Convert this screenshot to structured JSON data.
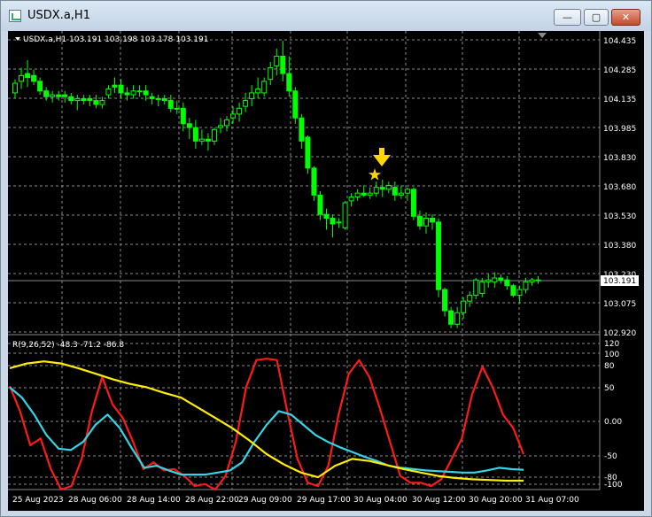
{
  "window": {
    "title": "USDX.a,H1",
    "buttons": {
      "minimize": "—",
      "maximize": "▢",
      "close": "✕"
    }
  },
  "colors": {
    "background": "#000000",
    "grid": "#8a8a8a",
    "candle": "#00ff00",
    "rsi_fast": "#ff1a1a",
    "rsi_medium": "#33d6e6",
    "rsi_slow": "#ffee00",
    "marker": "#ffd700",
    "text": "#ffffff"
  },
  "main_chart": {
    "header": "USDX.a,H1  103.191 103.198 103.178 103.191",
    "price_axis": [
      "104.435",
      "104.285",
      "104.135",
      "103.985",
      "103.830",
      "103.680",
      "103.530",
      "103.380",
      "103.230",
      "103.075",
      "102.920"
    ],
    "current_price": "103.191",
    "marker_icons": [
      "arrow-down-icon",
      "star-icon"
    ]
  },
  "indicator": {
    "header": "R(9,26,52) -48.3 -71.2 -86.8",
    "axis": [
      "120",
      "100",
      "80",
      "50",
      "0.00",
      "-50",
      "-80",
      "-100"
    ]
  },
  "time_axis": [
    "25 Aug 2023",
    "28 Aug 06:00",
    "28 Aug 14:00",
    "28 Aug 22:00",
    "29 Aug 09:00",
    "29 Aug 17:00",
    "30 Aug 04:00",
    "30 Aug 12:00",
    "30 Aug 20:00",
    "31 Aug 07:00"
  ],
  "chart_data": [
    {
      "type": "candlestick",
      "symbol": "USDX.a",
      "timeframe": "H1",
      "ylim": [
        102.92,
        104.435
      ],
      "open": [
        104.16,
        104.22,
        104.26,
        104.25,
        104.22,
        104.17,
        104.14,
        104.15,
        104.15,
        104.14,
        104.12,
        104.13,
        104.13,
        104.12,
        104.1,
        104.15,
        104.2,
        104.2,
        104.16,
        104.15,
        104.17,
        104.17,
        104.14,
        104.13,
        104.13,
        104.12,
        104.08,
        104.08,
        104.0,
        103.98,
        103.91,
        103.92,
        103.91,
        103.98,
        103.99,
        104.03,
        104.05,
        104.09,
        104.13,
        104.16,
        104.16,
        104.23,
        104.3,
        104.35,
        104.26,
        104.17,
        104.03,
        103.93,
        103.77,
        103.63,
        103.53,
        103.51,
        103.49,
        103.46,
        103.6,
        103.62,
        103.64,
        103.63,
        103.64,
        103.67,
        103.66,
        103.67,
        103.63,
        103.64,
        103.66,
        103.52,
        103.47,
        103.51,
        103.49,
        103.14,
        103.03,
        102.96,
        103.02,
        103.08,
        103.11,
        103.12,
        103.18,
        103.18,
        103.2,
        103.19,
        103.16,
        103.11,
        103.14,
        103.18,
        103.19
      ],
      "high": [
        104.23,
        104.29,
        104.33,
        104.28,
        104.24,
        104.19,
        104.17,
        104.17,
        104.17,
        104.16,
        104.15,
        104.15,
        104.15,
        104.15,
        104.14,
        104.2,
        104.24,
        104.23,
        104.19,
        104.2,
        104.2,
        104.2,
        104.16,
        104.15,
        104.15,
        104.15,
        104.12,
        104.11,
        104.03,
        104.02,
        103.97,
        103.95,
        103.98,
        104.03,
        104.04,
        104.09,
        104.11,
        104.16,
        104.2,
        104.24,
        104.24,
        104.32,
        104.39,
        104.43,
        104.35,
        104.19,
        104.05,
        103.94,
        103.78,
        103.65,
        103.56,
        103.53,
        103.51,
        103.6,
        103.64,
        103.66,
        103.68,
        103.67,
        103.7,
        103.71,
        103.7,
        103.7,
        103.68,
        103.67,
        103.67,
        103.55,
        103.54,
        103.53,
        103.51,
        103.15,
        103.05,
        103.05,
        103.1,
        103.13,
        103.2,
        103.2,
        103.22,
        103.23,
        103.22,
        103.21,
        103.17,
        103.16,
        103.2,
        103.2,
        103.21
      ],
      "low": [
        104.13,
        104.18,
        104.19,
        104.2,
        104.15,
        104.12,
        104.11,
        104.12,
        104.11,
        104.1,
        104.07,
        104.1,
        104.09,
        104.08,
        104.08,
        104.13,
        104.16,
        104.13,
        104.12,
        104.13,
        104.14,
        104.12,
        104.1,
        104.09,
        104.1,
        104.06,
        104.05,
        103.96,
        103.92,
        103.87,
        103.89,
        103.86,
        103.89,
        103.95,
        103.96,
        104.0,
        104.01,
        104.06,
        104.09,
        104.13,
        104.14,
        104.2,
        104.25,
        104.22,
        104.14,
        104.0,
        103.87,
        103.74,
        103.6,
        103.5,
        103.45,
        103.41,
        103.46,
        103.45,
        103.57,
        103.6,
        103.62,
        103.61,
        103.62,
        103.62,
        103.64,
        103.6,
        103.61,
        103.6,
        103.5,
        103.45,
        103.43,
        103.45,
        103.1,
        103.0,
        102.94,
        102.94,
        102.99,
        103.05,
        103.09,
        103.1,
        103.15,
        103.15,
        103.17,
        103.14,
        103.1,
        103.07,
        103.12,
        103.16,
        103.17
      ],
      "close": [
        104.21,
        104.25,
        104.24,
        104.22,
        104.17,
        104.14,
        104.15,
        104.14,
        104.14,
        104.12,
        104.13,
        104.12,
        104.12,
        104.1,
        104.12,
        104.18,
        104.19,
        104.16,
        104.15,
        104.17,
        104.17,
        104.15,
        104.13,
        104.13,
        104.12,
        104.08,
        104.08,
        104.0,
        103.98,
        103.91,
        103.92,
        103.91,
        103.97,
        103.99,
        104.02,
        104.05,
        104.08,
        104.12,
        104.16,
        104.18,
        104.22,
        104.29,
        104.35,
        104.26,
        104.17,
        104.03,
        103.91,
        103.77,
        103.63,
        103.53,
        103.51,
        103.48,
        103.49,
        103.59,
        103.62,
        103.64,
        103.63,
        103.64,
        103.67,
        103.66,
        103.68,
        103.63,
        103.64,
        103.66,
        103.52,
        103.47,
        103.51,
        103.49,
        103.14,
        103.03,
        102.96,
        103.02,
        103.08,
        103.11,
        103.19,
        103.18,
        103.19,
        103.2,
        103.19,
        103.16,
        103.11,
        103.14,
        103.18,
        103.19,
        103.19
      ]
    },
    {
      "type": "line",
      "name": "R(9,26,52)",
      "ylim": [
        -110,
        120
      ],
      "series": [
        {
          "name": "9",
          "values": [
            52,
            15,
            -35,
            -25,
            -70,
            -100,
            -95,
            -55,
            15,
            65,
            25,
            5,
            -30,
            -70,
            -60,
            -72,
            -70,
            -80,
            -95,
            -92,
            -100,
            -80,
            -30,
            50,
            90,
            92,
            90,
            15,
            -55,
            -90,
            -95,
            -65,
            10,
            70,
            90,
            65,
            20,
            -30,
            -80,
            -90,
            -90,
            -95,
            -85,
            -55,
            -25,
            40,
            80,
            50,
            10,
            -10,
            -48
          ]
        },
        {
          "name": "26",
          "values": [
            50,
            35,
            10,
            -20,
            -40,
            -42,
            -30,
            -5,
            10,
            -10,
            -40,
            -68,
            -65,
            -72,
            -78,
            -78,
            -78,
            -75,
            -72,
            -60,
            -30,
            -5,
            15,
            10,
            -5,
            -20,
            -30,
            -38,
            -45,
            -52,
            -58,
            -65,
            -68,
            -70,
            -72,
            -73,
            -74,
            -75,
            -75,
            -72,
            -68,
            -70,
            -71
          ]
        },
        {
          "name": "52",
          "values": [
            78,
            85,
            88,
            85,
            78,
            70,
            62,
            55,
            50,
            42,
            35,
            20,
            5,
            -10,
            -28,
            -48,
            -63,
            -75,
            -82,
            -65,
            -55,
            -58,
            -64,
            -70,
            -75,
            -80,
            -83,
            -85,
            -86,
            -87,
            -87
          ]
        }
      ]
    }
  ]
}
